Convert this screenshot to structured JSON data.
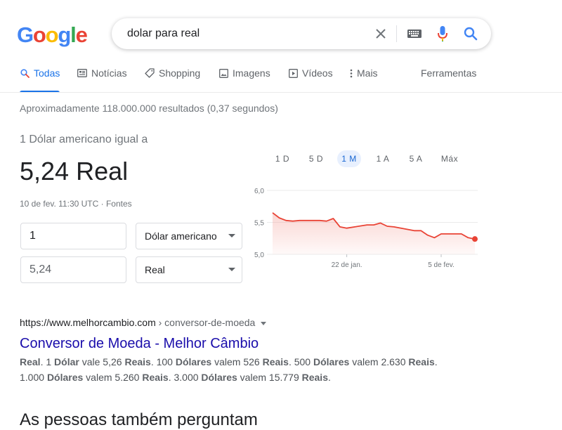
{
  "search": {
    "query": "dolar para real"
  },
  "logo": {
    "letters": [
      "G",
      "o",
      "o",
      "g",
      "l",
      "e"
    ],
    "colors": [
      "#4285F4",
      "#EA4335",
      "#FBBC05",
      "#4285F4",
      "#34A853",
      "#EA4335"
    ]
  },
  "search_icons": {
    "clear": "close-icon",
    "keyboard": "keyboard-icon",
    "voice": "microphone-icon",
    "search": "search-icon"
  },
  "tabs": [
    {
      "label": "Todas",
      "icon": "search-icon",
      "active": true
    },
    {
      "label": "Notícias",
      "icon": "news-icon"
    },
    {
      "label": "Shopping",
      "icon": "tag-icon"
    },
    {
      "label": "Imagens",
      "icon": "image-icon"
    },
    {
      "label": "Vídeos",
      "icon": "video-icon"
    },
    {
      "label": "Mais",
      "icon": "more-vert-icon"
    }
  ],
  "tools_label": "Ferramentas",
  "results_stats": "Aproximadamente 118.000.000 resultados (0,37 segundos)",
  "converter": {
    "title": "1 Dólar americano igual a",
    "value": "5,24 Real",
    "timestamp": "10 de fev. 11:30 UTC",
    "separator": " · ",
    "sources": "Fontes",
    "from_amount": "1",
    "from_currency": "Dólar americano",
    "to_amount": "5,24",
    "to_currency": "Real"
  },
  "chart_ranges": [
    "1 D",
    "5 D",
    "1 M",
    "1 A",
    "5 A",
    "Máx"
  ],
  "chart_active_range": "1 M",
  "colors": {
    "accent": "#1a73e8",
    "link": "#1a0dab",
    "chart_line": "#e94335"
  },
  "chart_data": {
    "type": "area",
    "y_ticks": [
      "6,0",
      "5,5",
      "5,0"
    ],
    "ylim": [
      5.0,
      6.0
    ],
    "x_tick_labels": [
      "22 de jan.",
      "5 de fev."
    ],
    "x": [
      "2021-01-11",
      "2021-01-12",
      "2021-01-13",
      "2021-01-14",
      "2021-01-15",
      "2021-01-18",
      "2021-01-19",
      "2021-01-20",
      "2021-01-21",
      "2021-01-22",
      "2021-01-25",
      "2021-01-26",
      "2021-01-27",
      "2021-01-28",
      "2021-01-29",
      "2021-02-01",
      "2021-02-02",
      "2021-02-03",
      "2021-02-04",
      "2021-02-05",
      "2021-02-08",
      "2021-02-09",
      "2021-02-10"
    ],
    "values": [
      5.65,
      5.57,
      5.53,
      5.52,
      5.53,
      5.53,
      5.52,
      5.56,
      5.43,
      5.41,
      5.46,
      5.46,
      5.49,
      5.44,
      5.43,
      5.37,
      5.37,
      5.3,
      5.26,
      5.32,
      5.32,
      5.26,
      5.24
    ],
    "last_value": 5.24,
    "grid": true
  },
  "result": {
    "url": "https://www.melhorcambio.com",
    "breadcrumb": " › conversor-de-moeda",
    "title": "Conversor de Moeda - Melhor Câmbio",
    "snippet_parts": [
      {
        "t": "Real",
        "b": true
      },
      {
        "t": ". 1 ",
        "b": false
      },
      {
        "t": "Dólar",
        "b": true
      },
      {
        "t": " vale 5,26 ",
        "b": false
      },
      {
        "t": "Reais",
        "b": true
      },
      {
        "t": ". 100 ",
        "b": false
      },
      {
        "t": "Dólares",
        "b": true
      },
      {
        "t": " valem 526 ",
        "b": false
      },
      {
        "t": "Reais",
        "b": true
      },
      {
        "t": ". 500 ",
        "b": false
      },
      {
        "t": "Dólares",
        "b": true
      },
      {
        "t": " valem 2.630 ",
        "b": false
      },
      {
        "t": "Reais",
        "b": true
      },
      {
        "t": ". 1.000 ",
        "b": false
      },
      {
        "t": "Dólares",
        "b": true
      },
      {
        "t": " valem 5.260 ",
        "b": false
      },
      {
        "t": "Reais",
        "b": true
      },
      {
        "t": ". 3.000 ",
        "b": false
      },
      {
        "t": "Dólares",
        "b": true
      },
      {
        "t": " valem 15.779 ",
        "b": false
      },
      {
        "t": "Reais",
        "b": true
      },
      {
        "t": ".",
        "b": false
      }
    ]
  },
  "next_heading": "As pessoas também perguntam"
}
